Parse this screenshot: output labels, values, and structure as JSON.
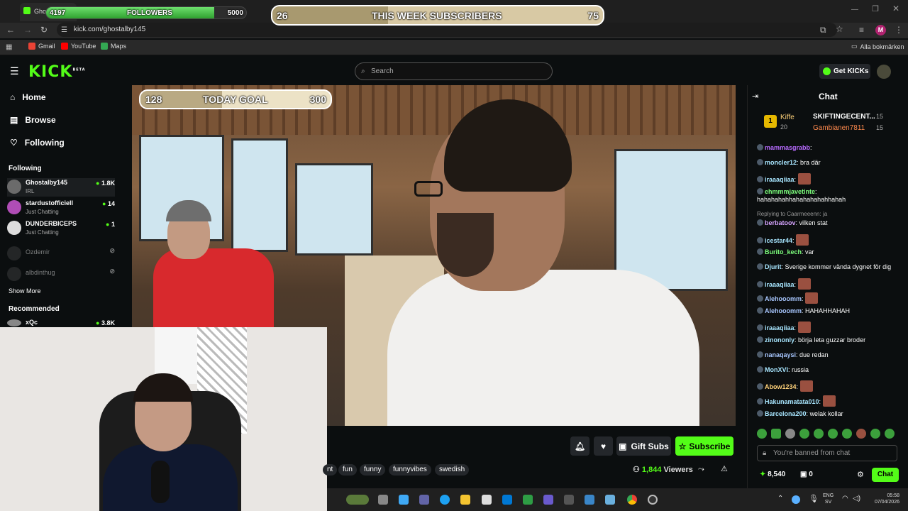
{
  "browser": {
    "tab_title": "Ghostalby145",
    "url": "kick.com/ghostalby145",
    "bookmarks": [
      {
        "label": "Gmail",
        "color": "#ea4335"
      },
      {
        "label": "YouTube",
        "color": "#ff0000"
      },
      {
        "label": "Maps",
        "color": "#34a853"
      }
    ],
    "all_bookmarks": "Alla bokmärken",
    "profile_initial": "M"
  },
  "overlays": {
    "followers": {
      "current": "4197",
      "label": "FOLLOWERS",
      "goal": "5000",
      "progress": 0.84
    },
    "subs": {
      "current": "26",
      "label": "THIS WEEK SUBSCRIBERS",
      "goal": "75",
      "progress": 0.35
    },
    "today": {
      "current": "128",
      "label": "TODAY GOAL",
      "goal": "300",
      "progress": 0.43
    }
  },
  "header": {
    "logo": "KICK",
    "logo_beta": "BETA",
    "search_placeholder": "Search",
    "get_kicks": "Get KICKs"
  },
  "sidebar": {
    "nav": [
      {
        "label": "Home",
        "icon": "home-icon"
      },
      {
        "label": "Browse",
        "icon": "browse-icon"
      },
      {
        "label": "Following",
        "icon": "heart-icon"
      }
    ],
    "following_title": "Following",
    "following": [
      {
        "name": "Ghostalby145",
        "category": "IRL",
        "viewers": "1.8K",
        "color": "#6b6b6b"
      },
      {
        "name": "stardustofficiell",
        "category": "Just Chatting",
        "viewers": "14",
        "color": "#b04db6"
      },
      {
        "name": "DUNDERBICEPS",
        "category": "Just Chatting",
        "viewers": "1",
        "color": "#ddd"
      },
      {
        "name": "Ozdemir",
        "category": "",
        "viewers": "",
        "color": "#444"
      },
      {
        "name": "albdinthug",
        "category": "",
        "viewers": "",
        "color": "#444"
      }
    ],
    "show_more": "Show More",
    "recommended_title": "Recommended",
    "recommended": [
      {
        "name": "xQc",
        "viewers": "3.8K"
      }
    ]
  },
  "stream": {
    "buttons": {
      "gift": "Gift Subs",
      "subscribe": "Subscribe"
    },
    "tags": [
      "nt",
      "fun",
      "funny",
      "funnyvibes",
      "swedish"
    ],
    "viewers": "1,844",
    "viewers_label": "Viewers"
  },
  "chat": {
    "title": "Chat",
    "leaderboard": [
      {
        "rank": "1",
        "name": "Kiffe",
        "count": "20"
      },
      {
        "name": "SKIFTINGECENT...",
        "count": "15"
      },
      {
        "name": "Gambianen7811",
        "count": "15"
      }
    ],
    "messages": [
      {
        "user": "mammasgrabb",
        "text": "",
        "color": "#b86bff"
      },
      {
        "user": "moncler12",
        "text": "bra där",
        "color": "#a8e6ff"
      },
      {
        "user": "iraaaqiiaa",
        "text": "",
        "color": "#a8e6ff",
        "emote": true
      },
      {
        "user": "ehmmmjavetinte",
        "text": "hahahahahhahahahahahhahah",
        "color": "#7dff7d"
      },
      {
        "reply": "Replying to Caarmeeenn: ja"
      },
      {
        "user": "berbatoov",
        "text": "vilken stat",
        "color": "#d6a4ff"
      },
      {
        "user": "icestar44",
        "text": "",
        "color": "#a8e6ff",
        "emote": true
      },
      {
        "user": "Burito_kech",
        "text": "var",
        "color": "#7dff7d"
      },
      {
        "user": "Djurit",
        "text": "Sverige kommer vända dygnet för dig",
        "color": "#a8e6ff"
      },
      {
        "user": "iraaaqiiaa",
        "text": "",
        "color": "#a8e6ff",
        "emote": true
      },
      {
        "user": "Alehooomm",
        "text": "",
        "color": "#a8c7ff",
        "emote": true
      },
      {
        "user": "Alehooomm",
        "text": "HAHAHHAHAH",
        "color": "#a8c7ff"
      },
      {
        "user": "iraaaqiiaa",
        "text": "",
        "color": "#a8e6ff",
        "emote": true
      },
      {
        "user": "zinononly",
        "text": "börja leta guzzar broder",
        "color": "#a8e6ff"
      },
      {
        "user": "nanaqaysi",
        "text": "due redan",
        "color": "#a8c7ff"
      },
      {
        "user": "MonXVI",
        "text": "russia",
        "color": "#a8e6ff"
      },
      {
        "user": "Abow1234",
        "text": "",
        "color": "#ffd27a",
        "emote": true
      },
      {
        "user": "Hakunamatata010",
        "text": "",
        "color": "#a8e6ff",
        "emote": true
      },
      {
        "user": "Barcelona200",
        "text": "welak kollar",
        "color": "#a8e6ff"
      }
    ],
    "input_placeholder": "You're banned from chat",
    "points": "8,540",
    "gifts": "0",
    "send": "Chat"
  },
  "taskbar": {
    "lang": "ENG",
    "lang_sub": "SV",
    "time": "05:58",
    "date": "07/04/2026"
  }
}
